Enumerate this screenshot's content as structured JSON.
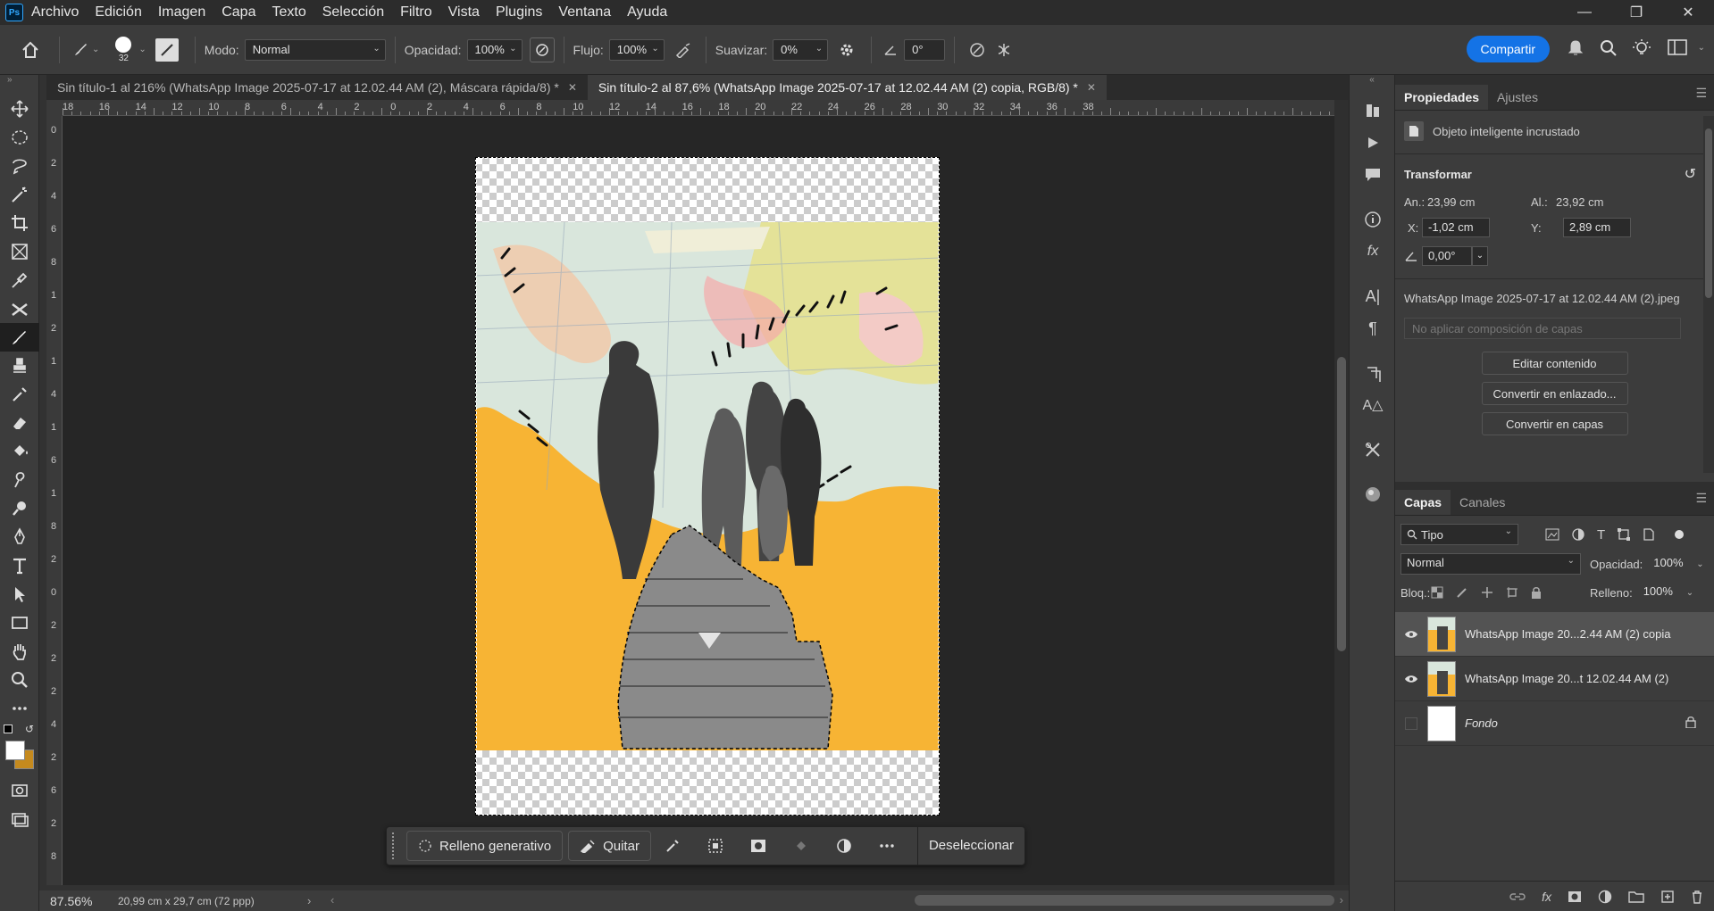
{
  "app": {
    "logo": "Ps"
  },
  "menu": [
    "Archivo",
    "Edición",
    "Imagen",
    "Capa",
    "Texto",
    "Selección",
    "Filtro",
    "Vista",
    "Plugins",
    "Ventana",
    "Ayuda"
  ],
  "options": {
    "brush_size": "32",
    "mode_label": "Modo:",
    "mode_value": "Normal",
    "opacity_label": "Opacidad:",
    "opacity_value": "100%",
    "flow_label": "Flujo:",
    "flow_value": "100%",
    "smooth_label": "Suavizar:",
    "smooth_value": "0%",
    "angle_value": "0°",
    "share_label": "Compartir"
  },
  "tabs": [
    {
      "label": "Sin título-1 al 216% (WhatsApp Image 2025-07-17 at 12.02.44 AM (2), Máscara rápida/8) *",
      "active": false
    },
    {
      "label": "Sin título-2 al 87,6% (WhatsApp Image 2025-07-17 at 12.02.44 AM (2) copia, RGB/8) *",
      "active": true
    }
  ],
  "ruler_top": [
    "18",
    "16",
    "14",
    "12",
    "10",
    "8",
    "6",
    "4",
    "2",
    "0",
    "2",
    "4",
    "6",
    "8",
    "10",
    "12",
    "14",
    "16",
    "18",
    "20",
    "22",
    "24",
    "26",
    "28",
    "30",
    "32",
    "34",
    "36",
    "38"
  ],
  "ruler_left": [
    "0",
    "2",
    "4",
    "6",
    "8",
    "1",
    "2",
    "1",
    "4",
    "1",
    "6",
    "1",
    "8",
    "2",
    "0",
    "2",
    "2",
    "2",
    "4",
    "2",
    "6",
    "2",
    "8"
  ],
  "context_bar": {
    "generative_fill": "Relleno generativo",
    "remove": "Quitar",
    "deselect": "Deseleccionar"
  },
  "status": {
    "zoom": "87.56%",
    "doc_info": "20,99 cm x 29,7 cm (72 ppp)"
  },
  "properties": {
    "tabs": [
      "Propiedades",
      "Ajustes"
    ],
    "object_type": "Objeto inteligente incrustado",
    "transform_title": "Transformar",
    "width_label": "An.:",
    "width_value": "23,99 cm",
    "height_label": "Al.:",
    "height_value": "23,92 cm",
    "x_label": "X:",
    "x_value": "-1,02 cm",
    "y_label": "Y:",
    "y_value": "2,89 cm",
    "angle_value": "0,00°",
    "source_file": "WhatsApp Image 2025-07-17 at 12.02.44 AM (2).jpeg",
    "layer_comp_placeholder": "No aplicar composición de capas",
    "btn_edit": "Editar contenido",
    "btn_linked": "Convertir en enlazado...",
    "btn_layers": "Convertir en capas"
  },
  "layers_panel": {
    "tabs": [
      "Capas",
      "Canales"
    ],
    "filter": "Tipo",
    "blend_mode": "Normal",
    "opacity_label": "Opacidad:",
    "opacity_value": "100%",
    "lock_label": "Bloq.:",
    "fill_label": "Relleno:",
    "fill_value": "100%",
    "layers": [
      {
        "name": "WhatsApp Image 20...2.44 AM (2) copia",
        "visible": true,
        "selected": true
      },
      {
        "name": "WhatsApp Image 20...t 12.02.44 AM (2)",
        "visible": true,
        "selected": false
      },
      {
        "name": "Fondo",
        "visible": false,
        "selected": false,
        "locked": true
      }
    ]
  },
  "colors": {
    "accent": "#1473e6",
    "background_art": "#f7b434"
  }
}
